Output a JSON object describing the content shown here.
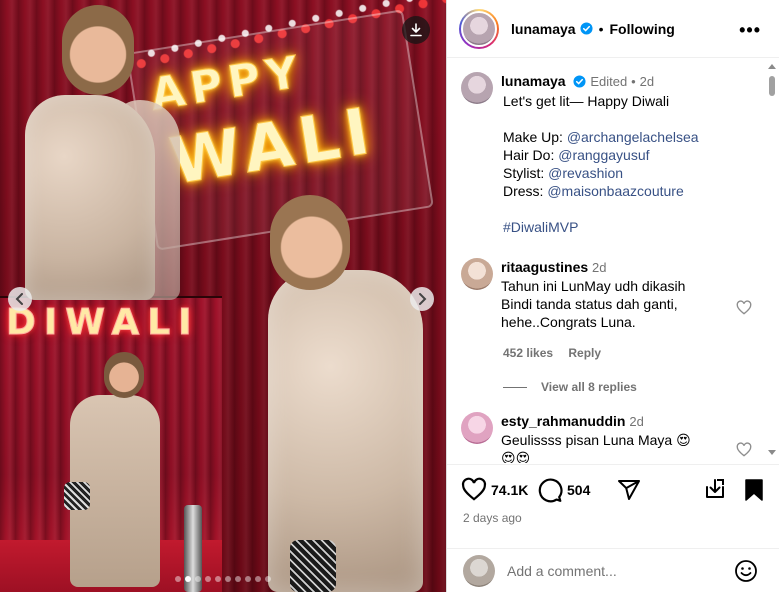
{
  "post": {
    "username": "lunamaya",
    "follow_label": "Following",
    "more_label": "•••",
    "separator": "•",
    "verified_icon": "verified-badge-icon",
    "accent": "#0095f6",
    "link_color": "#385185"
  },
  "media": {
    "neon_top": "APPY",
    "neon_main": "WALI",
    "neon_lower": "DIWALI",
    "carousel_total": 10,
    "carousel_active": 2
  },
  "caption": {
    "username": "lunamaya",
    "edited": "Edited",
    "dot": "•",
    "age": "2d",
    "line1": "Let's get lit— Happy Diwali  ",
    "makeup_label": "Make Up: ",
    "makeup_handle": "@archangelachelsea",
    "hair_label": "Hair Do: ",
    "hair_handle": "@ranggayusuf",
    "stylist_label": "Stylist: ",
    "stylist_handle": "@revashion",
    "dress_label": "Dress: ",
    "dress_handle": "@maisonbaazcouture",
    "hashtag": "#DiwaliMVP"
  },
  "comments": [
    {
      "username": "ritaagustines",
      "age": "2d",
      "text_1": "Tahun ini LunMay udh dikasih",
      "text_2": "Bindi tanda status dah ganti,",
      "text_3": "hehe..Congrats Luna.",
      "likes": "452 likes",
      "reply": "Reply",
      "view_replies": "View all 8 replies"
    },
    {
      "username": "esty_rahmanuddin",
      "age": "2d",
      "text_1": "Geulissss pisan Luna Maya 😍",
      "text_2": "😍😍"
    }
  ],
  "actions": {
    "likes_count": "74.1K",
    "comments_count": "504",
    "time_ago": "2 days ago"
  },
  "composer": {
    "placeholder": "Add a comment..."
  }
}
